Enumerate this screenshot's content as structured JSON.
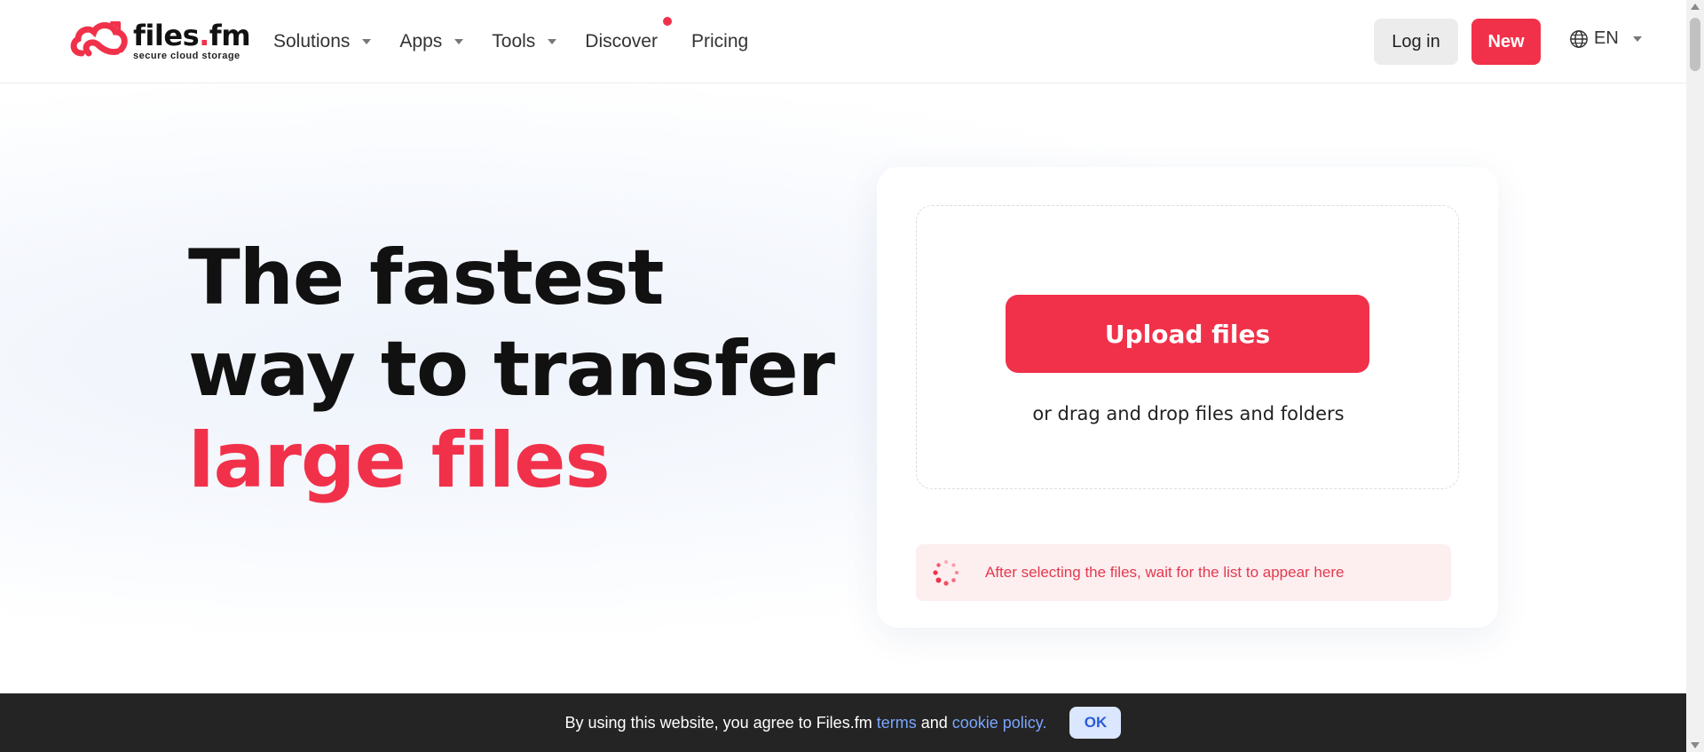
{
  "brand": {
    "name_main": "files",
    "name_dot": ".",
    "name_tld": "fm",
    "tagline": "secure cloud storage",
    "accent_color": "#f1314a"
  },
  "nav": {
    "items": [
      {
        "label": "Solutions",
        "has_dropdown": true
      },
      {
        "label": "Apps",
        "has_dropdown": true
      },
      {
        "label": "Tools",
        "has_dropdown": true
      },
      {
        "label": "Discover",
        "has_dropdown": false,
        "notification_dot": true
      },
      {
        "label": "Pricing",
        "has_dropdown": false
      }
    ]
  },
  "header": {
    "login_label": "Log in",
    "new_label": "New",
    "language": "EN"
  },
  "hero": {
    "line1": "The fastest",
    "line2": "way to transfer",
    "line3": "large files"
  },
  "upload": {
    "button_label": "Upload files",
    "drop_hint": "or drag and drop files and folders",
    "notice": "After selecting the files, wait for the list to appear here"
  },
  "cookie": {
    "text_before": "By using this website, you agree to Files.fm ",
    "terms_link": "terms",
    "text_middle": " and ",
    "policy_link": "cookie policy.",
    "ok_label": "OK"
  }
}
